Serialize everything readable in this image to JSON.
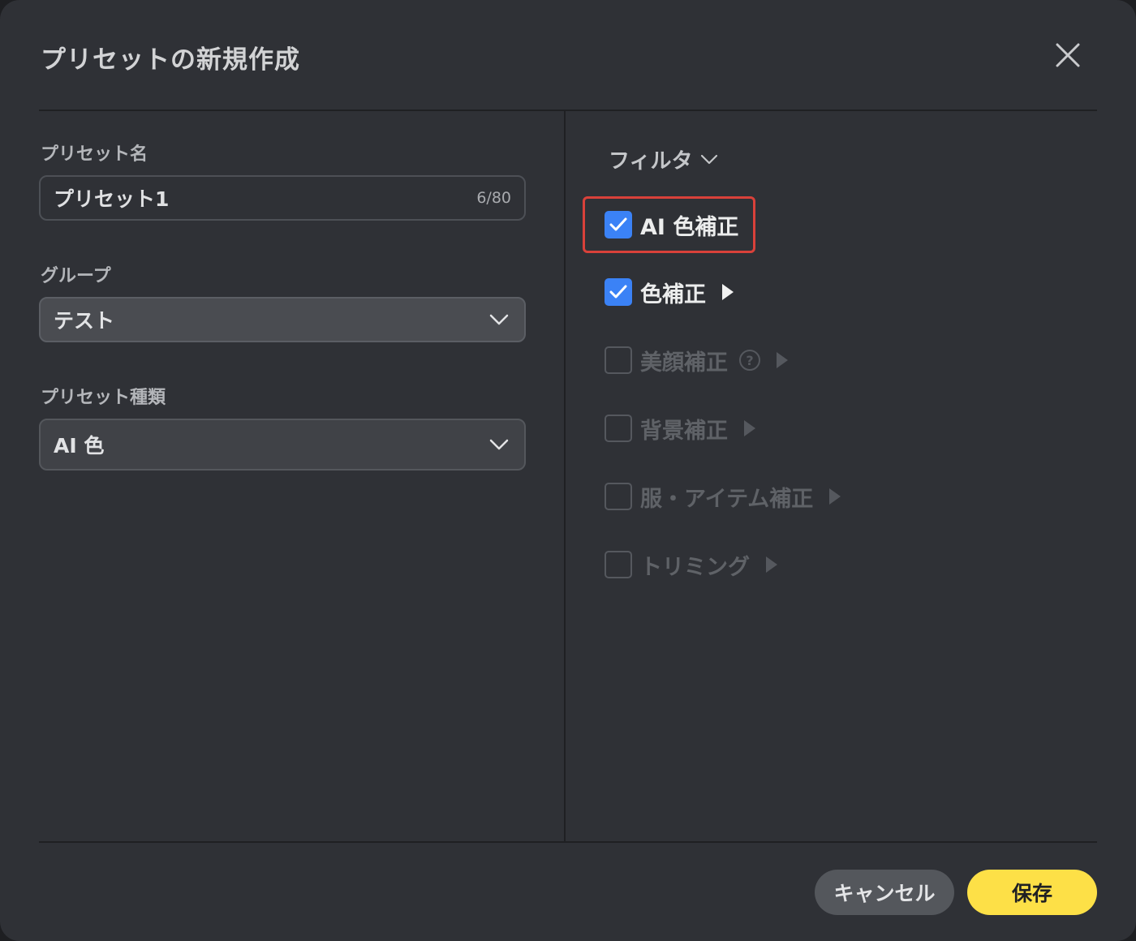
{
  "dialog": {
    "title": "プリセットの新規作成"
  },
  "form": {
    "name_label": "プリセット名",
    "name_value": "プリセット1",
    "name_counter": "6/80",
    "group_label": "グループ",
    "group_value": "テスト",
    "type_label": "プリセット種類",
    "type_value": "AI 色"
  },
  "filters": {
    "heading": "フィルタ",
    "items": [
      {
        "label": "AI 色補正",
        "checked": true,
        "enabled": true
      },
      {
        "label": "色補正",
        "checked": true,
        "enabled": true
      },
      {
        "label": "美顔補正",
        "checked": false,
        "enabled": false
      },
      {
        "label": "背景補正",
        "checked": false,
        "enabled": false
      },
      {
        "label": "服・アイテム補正",
        "checked": false,
        "enabled": false
      },
      {
        "label": "トリミング",
        "checked": false,
        "enabled": false
      }
    ],
    "help_glyph": "?"
  },
  "footer": {
    "cancel_label": "キャンセル",
    "save_label": "保存"
  },
  "colors": {
    "checkbox_on": "#3b82f6",
    "save_button": "#fde047",
    "highlight_border": "#d9413a"
  }
}
